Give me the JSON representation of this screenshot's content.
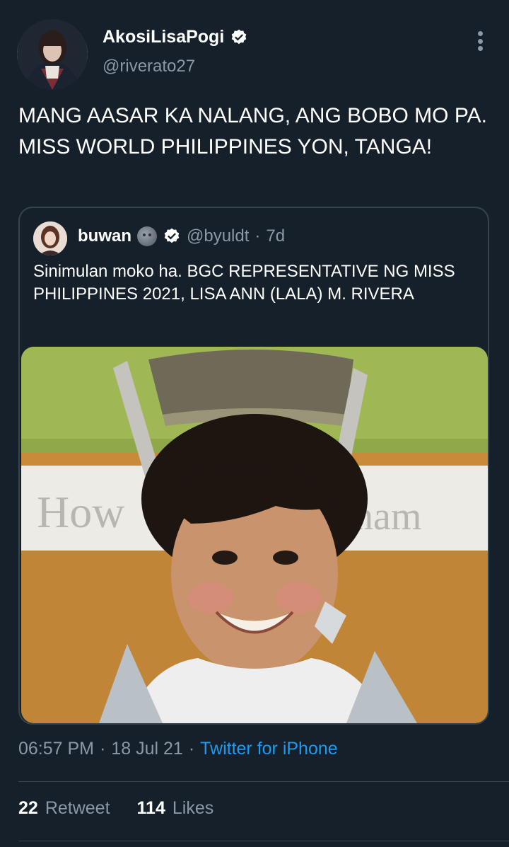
{
  "author": {
    "display_name": "AkosiLisaPogi",
    "handle": "@riverato27"
  },
  "tweet": {
    "text": "MANG AASAR KA NALANG, ANG BOBO MO PA. MISS WORLD PHILIPPINES YON, TANGA!"
  },
  "quoted": {
    "display_name": "buwan",
    "handle": "@byuldt",
    "separator": "·",
    "time": "7d",
    "text": "Sinimulan moko ha. BGC REPRESENTATIVE NG MISS PHILIPPINES 2021, LISA ANN (LALA) M. RIVERA"
  },
  "meta": {
    "time": "06:57 PM",
    "sep1": "·",
    "date": "18 Jul 21",
    "sep2": "·",
    "source": "Twitter for iPhone"
  },
  "stats": {
    "retweets_count": "22",
    "retweets_label": "Retweet",
    "likes_count": "114",
    "likes_label": "Likes"
  },
  "colors": {
    "background": "#15202b",
    "muted": "#8b98a5",
    "accent": "#1d9bf0",
    "border": "#38444d"
  },
  "icons": [
    "verified-badge-icon",
    "more-options-icon",
    "moon-emoji-icon"
  ]
}
